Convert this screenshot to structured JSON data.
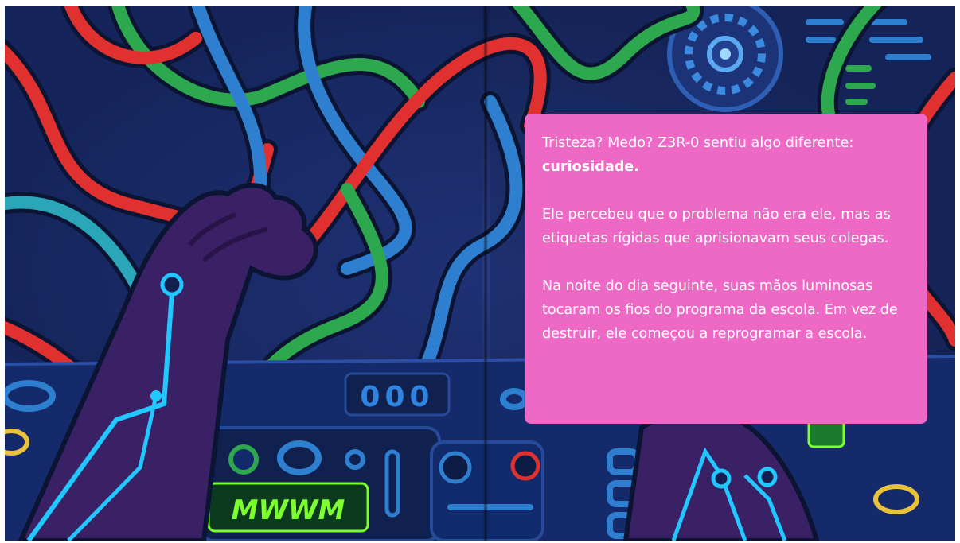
{
  "page": {
    "paragraph_1_prefix": "Tristeza? Medo? Z3R-0 sentiu algo diferente: ",
    "paragraph_1_emphasis": "curiosidade.",
    "paragraph_2": "Ele percebeu que o problema não era ele, mas as etiquetas rígidas que aprisionavam seus colegas.",
    "paragraph_3": "Na noite do dia seguinte, suas mãos luminosas tocaram os fios do programa da escola. Em vez de destruir, ele começou a reprogramar a escola."
  },
  "illustration": {
    "panel_label": "000",
    "wave_label": "MWWM"
  },
  "colors": {
    "background": "#13204f",
    "card": "#ee69c6",
    "wire_red": "#e0302f",
    "wire_green": "#2ea84f",
    "wire_blue": "#2f7fd0",
    "wire_teal": "#2aa6b8",
    "neon_cyan": "#21c8ff",
    "neon_green": "#7dff2e",
    "hand_purple": "#3a2166"
  }
}
